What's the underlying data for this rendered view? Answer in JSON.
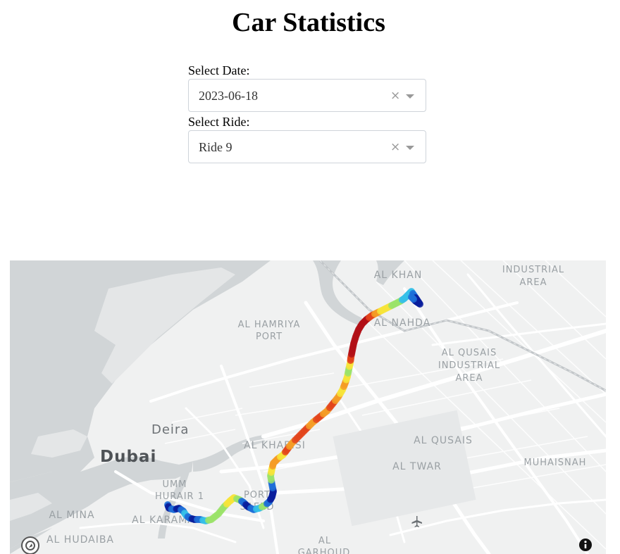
{
  "page": {
    "title": "Car Statistics"
  },
  "filters": {
    "date": {
      "label": "Select Date:",
      "value": "2023-06-18",
      "clear": "×"
    },
    "ride": {
      "label": "Select Ride:",
      "value": "Ride 9",
      "clear": "×"
    }
  },
  "map": {
    "places": {
      "al_khan": "AL KHAN",
      "industrial_area_1": "INDUSTRIAL",
      "industrial_area_2": "AREA",
      "al_hamriya_1": "AL HAMRIYA",
      "al_hamriya_2": "PORT",
      "al_nahda": "AL NAHDA",
      "al_qusais_ind_1": "AL QUSAIS",
      "al_qusais_ind_2": "INDUSTRIAL",
      "al_qusais_ind_3": "AREA",
      "deira": "Deira",
      "dubai": "Dubai",
      "al_khabisi": "AL KHABISI",
      "al_qusais": "AL QUSAIS",
      "muhaisnah": "MUHAISNAH",
      "al_twar": "AL TWAR",
      "umm_hurair_1": "UMM",
      "umm_hurair_2": "HURAIR 1",
      "port_saeed_1": "PORT",
      "port_saeed_2": "SAEED",
      "al_mina": "AL MINA",
      "al_karama": "AL KARAMA",
      "al_hudaiba": "AL HUDAIBA",
      "al_garhoud_1": "AL",
      "al_garhoud_2": "GARHOUD"
    },
    "icons": {
      "logo": "mapbox-logo-icon",
      "info": "info-icon",
      "airport": "airplane-icon"
    },
    "colorscale": [
      "#0a1f9c",
      "#1e6fd8",
      "#36c0e8",
      "#9be36a",
      "#f7e43a",
      "#f59c26",
      "#e3441b",
      "#b20f16"
    ]
  }
}
